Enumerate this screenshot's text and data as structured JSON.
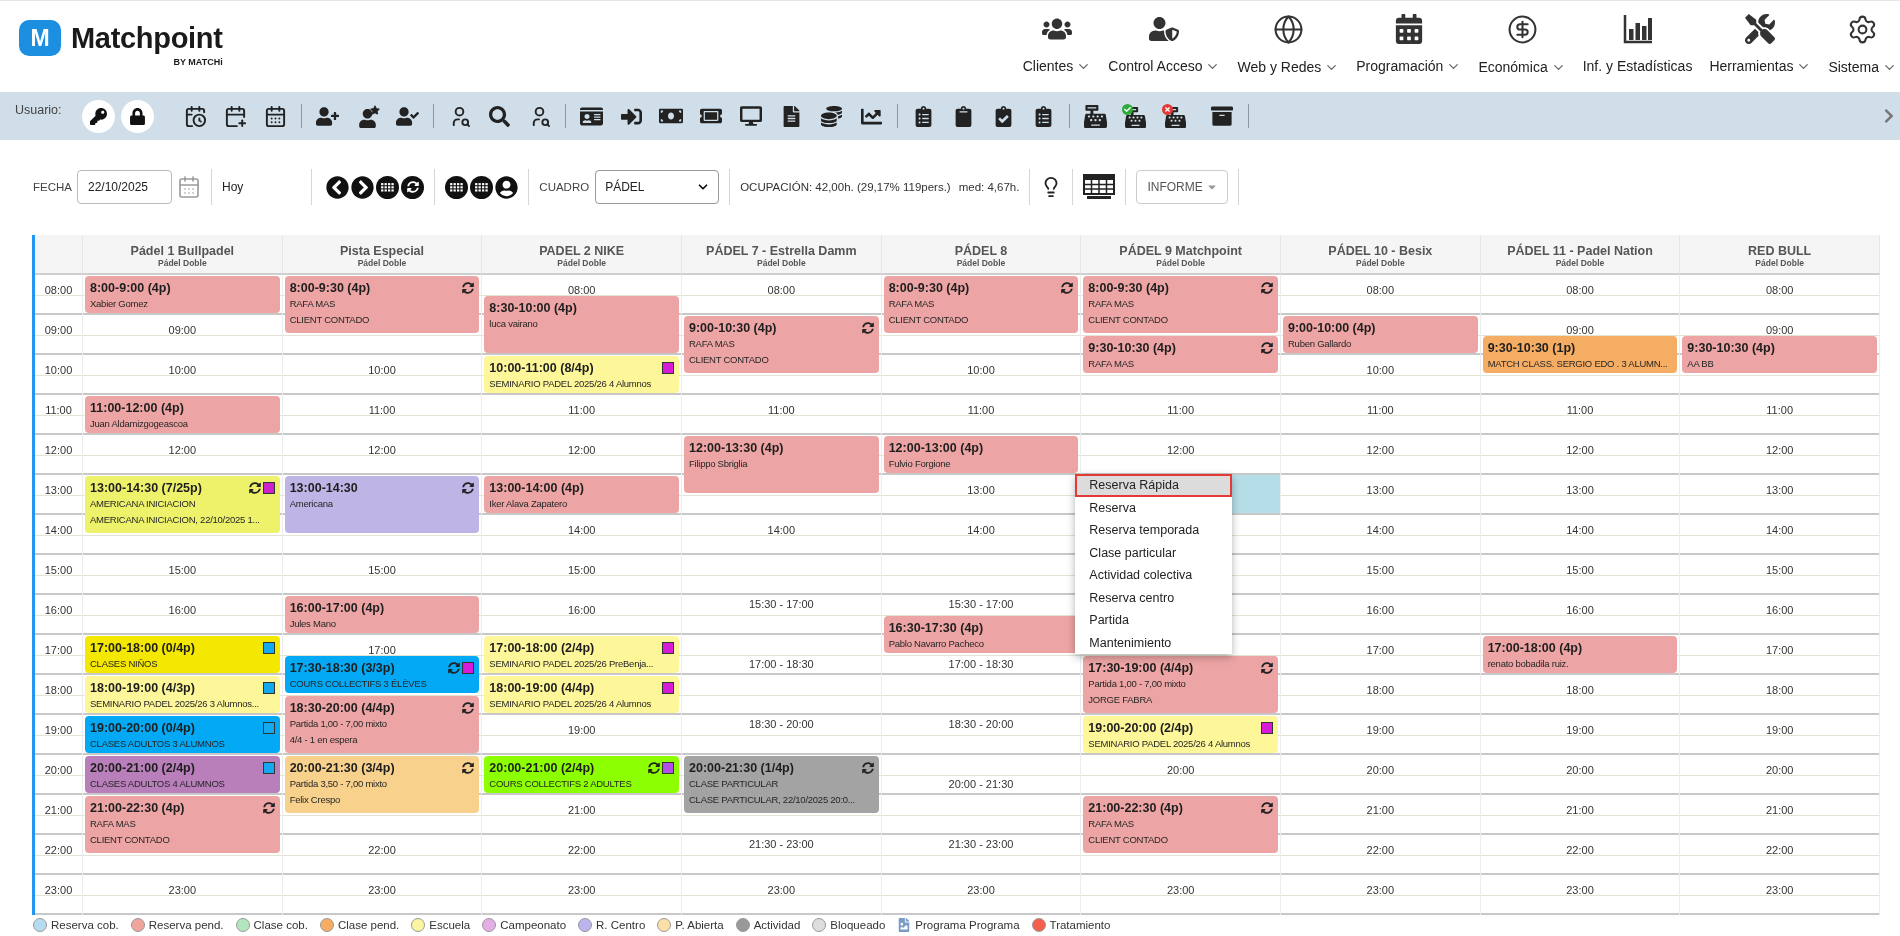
{
  "header": {
    "logo": {
      "mark": "M",
      "name": "Matchpoint",
      "byline": "BY MATCHi"
    },
    "nav": [
      {
        "label": "Clientes",
        "dropdown": true
      },
      {
        "label": "Control Acceso",
        "dropdown": true
      },
      {
        "label": "Web y Redes",
        "dropdown": true
      },
      {
        "label": "Programación",
        "dropdown": true
      },
      {
        "label": "Económica",
        "dropdown": true
      },
      {
        "label": "Inf. y Estadísticas",
        "dropdown": false
      },
      {
        "label": "Herramientas",
        "dropdown": true
      },
      {
        "label": "Sistema",
        "dropdown": true
      }
    ]
  },
  "toolbar": {
    "label": "Usuario:"
  },
  "filters": {
    "date_label": "FECHA",
    "date": "22/10/2025",
    "today": "Hoy",
    "board_label": "CUADRO",
    "board": "PÁDEL",
    "occupancy": "OCUPACIÓN: 42,00h. (29,17% 119pers.)",
    "average": "med: 4,67h.",
    "report": "INFORME"
  },
  "schedule": {
    "hours": [
      {
        "label": "08:00",
        "selected": false
      },
      {
        "label": "09:00",
        "selected": false
      },
      {
        "label": "10:00",
        "selected": false
      },
      {
        "label": "11:00",
        "selected": false
      },
      {
        "label": "12:00",
        "selected": false
      },
      {
        "label": "13:00",
        "selected": true
      },
      {
        "label": "14:00",
        "selected": false
      },
      {
        "label": "15:00",
        "selected": false
      },
      {
        "label": "16:00",
        "selected": false
      },
      {
        "label": "17:00",
        "selected": false
      },
      {
        "label": "18:00",
        "selected": false
      },
      {
        "label": "19:00",
        "selected": false
      },
      {
        "label": "20:00",
        "selected": false
      },
      {
        "label": "21:00",
        "selected": false
      },
      {
        "label": "22:00",
        "selected": false
      },
      {
        "label": "23:00",
        "selected": false
      }
    ],
    "courts": [
      {
        "name": "Pádel 1 Bullpadel",
        "type": "Pádel Doble",
        "selected": false,
        "free_slots": [
          "09:00",
          "10:00",
          "12:00",
          "15:00",
          "16:00",
          "23:00"
        ],
        "events": [
          {
            "title": "8:00-9:00 (4p)",
            "lines": [
              "Xabier Gomez"
            ],
            "color": "#eda4a4",
            "recurring": false
          },
          {
            "title": "11:00-12:00 (4p)",
            "lines": [
              "Juan Aldamizgogeascoa"
            ],
            "color": "#eda4a4",
            "recurring": false
          },
          {
            "title": "13:00-14:30 (7/25p)",
            "lines": [
              "AMERICANA INICIACION",
              "AMERICANA INICIACION, 22/10/2025 1..."
            ],
            "color": "#eef26b",
            "recurring": true,
            "flag": {
              "color": "#cc22cc"
            }
          },
          {
            "title": "17:00-18:00 (0/4p)",
            "lines": [
              "CLASES NIÑOS"
            ],
            "color": "#f4e800",
            "recurring": false,
            "flag": {
              "color": "#14a8f0"
            }
          },
          {
            "title": "18:00-19:00 (4/3p)",
            "lines": [
              "SEMINARIO PADEL 2025/26 3 Alumnos..."
            ],
            "color": "#fdf79a",
            "recurring": false,
            "flag": {
              "color": "#14a8f0"
            }
          },
          {
            "title": "19:00-20:00 (0/4p)",
            "lines": [
              "CLASES ADULTOS 3 ALUMNOS"
            ],
            "color": "#03a9f4",
            "recurring": false,
            "flag": {
              "color": "#14a8f0"
            }
          },
          {
            "title": "20:00-21:00 (2/4p)",
            "lines": [
              "CLASES ADULTOS 4 ALUMNOS"
            ],
            "color": "#b97fbb",
            "recurring": false,
            "flag": {
              "color": "#14a8f0"
            }
          },
          {
            "title": "21:00-22:30 (4p)",
            "lines": [
              "RAFA MAS",
              "CLIENT CONTADO"
            ],
            "color": "#eda4a4",
            "recurring": true
          }
        ]
      },
      {
        "name": "Pista Especial",
        "type": "Pádel Doble",
        "selected": false,
        "free_slots": [
          "10:00",
          "11:00",
          "12:00",
          "15:00",
          "17:00",
          "22:00",
          "23:00"
        ],
        "events": [
          {
            "title": "8:00-9:30 (4p)",
            "lines": [
              "RAFA MAS",
              "CLIENT CONTADO"
            ],
            "color": "#eda4a4",
            "recurring": true
          },
          {
            "title": "13:00-14:30",
            "lines": [
              "Americana"
            ],
            "color": "#beb5e6",
            "recurring": true
          },
          {
            "title": "16:00-17:00 (4p)",
            "lines": [
              "Jules Mano"
            ],
            "color": "#eda4a4",
            "recurring": false
          },
          {
            "title": "17:30-18:30 (3/3p)",
            "lines": [
              "COURS COLLECTIFS 3 ÉLÈVES"
            ],
            "color": "#03a9f4",
            "recurring": true,
            "flag": {
              "color": "#d81bd8"
            }
          },
          {
            "title": "18:30-20:00 (4/4p)",
            "lines": [
              "Partida 1,00 - 7,00 mixto",
              "4/4 - 1 en espera"
            ],
            "color": "#eda4a4",
            "recurring": true
          },
          {
            "title": "20:00-21:30 (3/4p)",
            "lines": [
              "Partida 3,50 - 7,00 mixto",
              "Felix Crespo"
            ],
            "color": "#f8d18c",
            "recurring": true
          }
        ]
      },
      {
        "name": "PADEL 2 NIKE",
        "type": "Pádel Doble",
        "selected": false,
        "free_slots": [
          "08:00",
          "11:00",
          "12:00",
          "14:00",
          "15:00",
          "16:00",
          "19:00",
          "21:00",
          "22:00",
          "23:00"
        ],
        "events": [
          {
            "title": "8:30-10:00 (4p)",
            "lines": [
              "luca vairano"
            ],
            "color": "#eda4a4",
            "recurring": false
          },
          {
            "title": "10:00-11:00 (8/4p)",
            "lines": [
              "SEMINARIO PADEL 2025/26 4 Alumnos"
            ],
            "color": "#fdf79a",
            "recurring": false,
            "flag": {
              "color": "#d81bd8"
            }
          },
          {
            "title": "13:00-14:00 (4p)",
            "lines": [
              "Iker Alava Zapatero"
            ],
            "color": "#eda4a4",
            "recurring": false
          },
          {
            "title": "17:00-18:00 (2/4p)",
            "lines": [
              "SEMINARIO PADEL 2025/26 PreBenja..."
            ],
            "color": "#fdf79a",
            "recurring": false,
            "flag": {
              "color": "#d81bd8"
            }
          },
          {
            "title": "18:00-19:00 (4/4p)",
            "lines": [
              "SEMINARIO PADEL 2025/26 4 Alumnos"
            ],
            "color": "#fdf79a",
            "recurring": false,
            "flag": {
              "color": "#d81bd8"
            }
          },
          {
            "title": "20:00-21:00 (2/4p)",
            "lines": [
              "COURS COLLECTIFS 2 ADULTES"
            ],
            "color": "#8cff00",
            "recurring": true,
            "flag": {
              "color": "#b34ee8"
            }
          }
        ]
      },
      {
        "name": "PÁDEL 7 - Estrella Damm",
        "type": "Pádel Doble",
        "selected": false,
        "free_slots": [
          "08:00",
          "11:00",
          "14:00",
          "15:30 - 17:00",
          "17:00 - 18:30",
          "18:30 - 20:00",
          "21:30 - 23:00",
          "23:00"
        ],
        "events": [
          {
            "title": "9:00-10:30 (4p)",
            "lines": [
              "RAFA MAS",
              "CLIENT CONTADO"
            ],
            "color": "#eda4a4",
            "recurring": true
          },
          {
            "title": "12:00-13:30 (4p)",
            "lines": [
              "Filippo Sbriglia"
            ],
            "color": "#eda4a4",
            "recurring": false
          },
          {
            "title": "20:00-21:30 (1/4p)",
            "lines": [
              "CLASE PARTICULAR",
              "CLASE PARTICULAR, 22/10/2025 20:0..."
            ],
            "color": "#a3a3a3",
            "recurring": true
          }
        ]
      },
      {
        "name": "PÁDEL 8",
        "type": "Pádel Doble",
        "selected": false,
        "free_slots": [
          "10:00",
          "11:00",
          "13:00",
          "14:00",
          "15:30 - 17:00",
          "17:00 - 18:30",
          "18:30 - 20:00",
          "20:00 - 21:30",
          "21:30 - 23:00",
          "23:00"
        ],
        "events": [
          {
            "title": "8:00-9:30 (4p)",
            "lines": [
              "RAFA MAS",
              "CLIENT CONTADO"
            ],
            "color": "#eda4a4",
            "recurring": true
          },
          {
            "title": "12:00-13:00 (4p)",
            "lines": [
              "Fulvio Forgione"
            ],
            "color": "#eda4a4",
            "recurring": false
          },
          {
            "title": "16:30-17:30 (4p)",
            "lines": [
              "Pablo Navarro Pacheco"
            ],
            "color": "#eda4a4",
            "recurring": false
          }
        ]
      },
      {
        "name": "PÁDEL 9 Matchpoint",
        "type": "Pádel Doble",
        "selected": true,
        "free_slots": [
          "11:00",
          "12:00",
          "20:00",
          "23:00"
        ],
        "events": [
          {
            "title": "8:00-9:30 (4p)",
            "lines": [
              "RAFA MAS",
              "CLIENT CONTADO"
            ],
            "color": "#eda4a4",
            "recurring": true
          },
          {
            "title": "9:30-10:30 (4p)",
            "lines": [
              "RAFA MAS"
            ],
            "color": "#eda4a4",
            "recurring": true
          },
          {
            "title": "17:30-19:00 (4/4p)",
            "lines": [
              "Partida 1,00 - 7,00 mixto",
              "JORGE FABRA"
            ],
            "color": "#eda4a4",
            "recurring": true
          },
          {
            "title": "19:00-20:00 (2/4p)",
            "lines": [
              "SEMINARIO PADEL 2025/26 4 Alumnos"
            ],
            "color": "#fdf79a",
            "recurring": false,
            "flag": {
              "color": "#d81bd8"
            }
          },
          {
            "title": "21:00-22:30 (4p)",
            "lines": [
              "RAFA MAS",
              "CLIENT CONTADO"
            ],
            "color": "#eda4a4",
            "recurring": true
          }
        ]
      },
      {
        "name": "PÁDEL 10 - Besix",
        "type": "Pádel Doble",
        "selected": false,
        "free_slots": [
          "08:00",
          "10:00",
          "11:00",
          "12:00",
          "13:00",
          "14:00",
          "15:00",
          "16:00",
          "17:00",
          "18:00",
          "19:00",
          "20:00",
          "21:00",
          "22:00",
          "23:00"
        ],
        "events": [
          {
            "title": "9:00-10:00 (4p)",
            "lines": [
              "Ruben Gallardo"
            ],
            "color": "#eda4a4",
            "recurring": false
          }
        ]
      },
      {
        "name": "PÁDEL 11 - Padel Nation",
        "type": "Pádel Doble",
        "selected": false,
        "free_slots": [
          "08:00",
          "09:00",
          "11:00",
          "12:00",
          "13:00",
          "14:00",
          "15:00",
          "16:00",
          "18:00",
          "19:00",
          "20:00",
          "21:00",
          "22:00",
          "23:00"
        ],
        "events": [
          {
            "title": "9:30-10:30 (1p)",
            "lines": [
              "MATCH CLASS. SERGIO EDO . 3 ALUMN..."
            ],
            "color": "#f5ad63",
            "recurring": false
          },
          {
            "title": "17:00-18:00 (4p)",
            "lines": [
              "renato bobadila ruiz."
            ],
            "color": "#eda4a4",
            "recurring": false
          }
        ]
      },
      {
        "name": "RED BULL",
        "type": "Pádel Doble",
        "selected": false,
        "free_slots": [
          "08:00",
          "09:00",
          "11:00",
          "12:00",
          "13:00",
          "14:00",
          "15:00",
          "16:00",
          "17:00",
          "18:00",
          "19:00",
          "20:00",
          "21:00",
          "22:00",
          "23:00"
        ],
        "events": [
          {
            "title": "9:30-10:30 (4p)",
            "lines": [
              "AA BB"
            ],
            "color": "#eda4a4",
            "recurring": false
          }
        ]
      }
    ],
    "context_menu": [
      {
        "label": "Reserva Rápida",
        "selected": true
      },
      {
        "label": "Reserva",
        "selected": false
      },
      {
        "label": "Reserva temporada",
        "selected": false
      },
      {
        "label": "Clase particular",
        "selected": false
      },
      {
        "label": "Actividad colectiva",
        "selected": false
      },
      {
        "label": "Reserva centro",
        "selected": false
      },
      {
        "label": "Partida",
        "selected": false
      },
      {
        "label": "Mantenimiento",
        "selected": false
      }
    ]
  },
  "legend": [
    {
      "kind": "swatch",
      "label": "Reserva cob.",
      "color": "#b5dcef"
    },
    {
      "kind": "swatch",
      "label": "Reserva pend.",
      "color": "#f0a59c"
    },
    {
      "kind": "swatch",
      "label": "Clase cob.",
      "color": "#b3e6bd"
    },
    {
      "kind": "swatch",
      "label": "Clase pend.",
      "color": "#f6ad62"
    },
    {
      "kind": "swatch",
      "label": "Escuela",
      "color": "#fbf5a1"
    },
    {
      "kind": "swatch",
      "label": "Campeonato",
      "color": "#e4aee6"
    },
    {
      "kind": "swatch",
      "label": "R. Centro",
      "color": "#bab5ee"
    },
    {
      "kind": "swatch",
      "label": "P. Abierta",
      "color": "#fbe0a8"
    },
    {
      "kind": "swatch",
      "label": "Actividad",
      "color": "#999999"
    },
    {
      "kind": "swatch",
      "label": "Bloqueado",
      "color": "#dddddd"
    },
    {
      "kind": "icon",
      "label": "Programa Programa"
    },
    {
      "kind": "swatch",
      "label": "Tratamiento",
      "color": "#f4604c"
    }
  ]
}
